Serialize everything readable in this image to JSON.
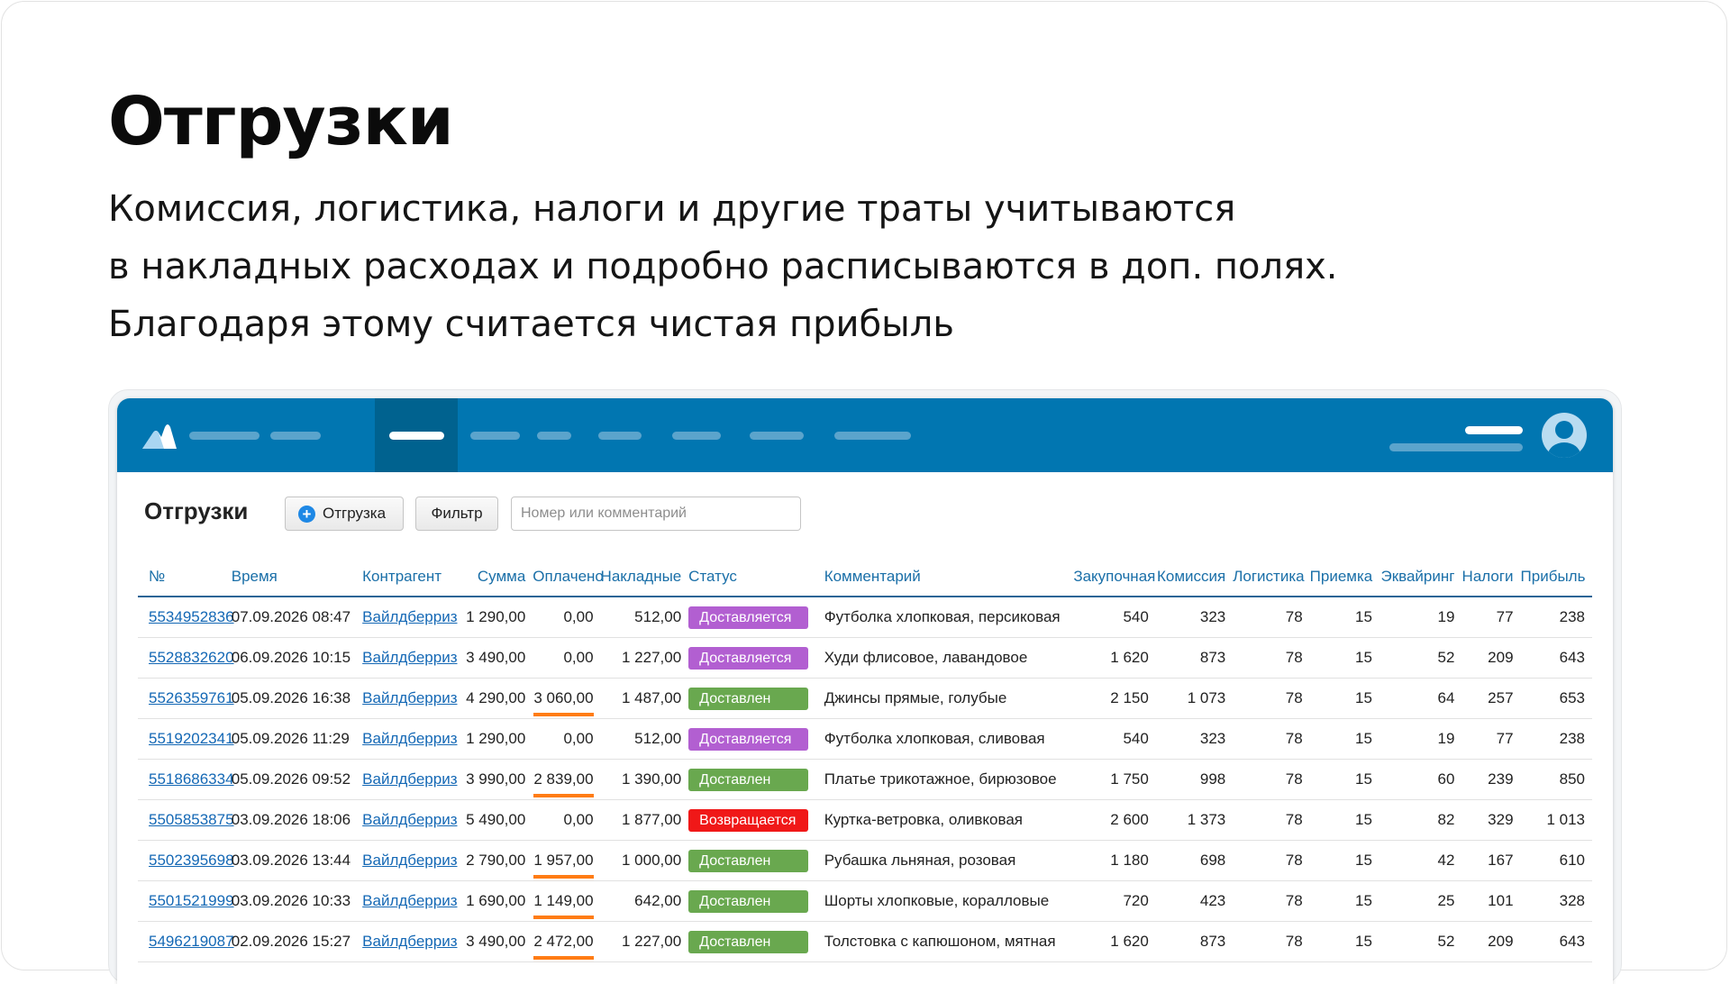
{
  "slide": {
    "title": "Отгрузки",
    "subtitle_lines": [
      "Комиссия, логистика, налоги и другие траты учитываются",
      "в накладных расходах и подробно расписываются в доп. полях.",
      "Благодаря этому считается чистая прибыль"
    ]
  },
  "app": {
    "colors": {
      "topbar": "#0176b1",
      "active_nav": "#00628f",
      "link": "#1468b5",
      "header_text": "#1a6fa8",
      "paid_highlight": "#ff7c14"
    },
    "logo_icon": "logo-icon",
    "avatar_icon": "user-avatar-icon"
  },
  "page": {
    "title": "Отгрузки",
    "add_button_label": "Отгрузка",
    "filter_button_label": "Фильтр",
    "search_placeholder": "Номер или комментарий"
  },
  "status_colors": {
    "Доставляется": "#b25fd1",
    "Доставлен": "#69a84f",
    "Возвращается": "#f01818"
  },
  "table": {
    "columns": [
      "№",
      "Время",
      "Контрагент",
      "Сумма",
      "Оплачено",
      "Накладные",
      "Статус",
      "Комментарий",
      "Закупочная",
      "Комиссия",
      "Логистика",
      "Приемка",
      "Эквайринг",
      "Налоги",
      "Прибыль"
    ],
    "rows": [
      {
        "num": "5534952836",
        "time": "07.09.2026 08:47",
        "agent": "Вайлдберриз",
        "sum": "1 290,00",
        "paid": "0,00",
        "paid_hl": false,
        "overhead": "512,00",
        "status": "Доставляется",
        "comment": "Футболка хлопковая, персиковая",
        "purchase": "540",
        "commission": "323",
        "logistics": "78",
        "acceptance": "15",
        "acquiring": "19",
        "taxes": "77",
        "profit": "238"
      },
      {
        "num": "5528832620",
        "time": "06.09.2026 10:15",
        "agent": "Вайлдберриз",
        "sum": "3 490,00",
        "paid": "0,00",
        "paid_hl": false,
        "overhead": "1 227,00",
        "status": "Доставляется",
        "comment": "Худи флисовое, лавандовое",
        "purchase": "1 620",
        "commission": "873",
        "logistics": "78",
        "acceptance": "15",
        "acquiring": "52",
        "taxes": "209",
        "profit": "643"
      },
      {
        "num": "5526359761",
        "time": "05.09.2026 16:38",
        "agent": "Вайлдберриз",
        "sum": "4 290,00",
        "paid": "3 060,00",
        "paid_hl": true,
        "overhead": "1 487,00",
        "status": "Доставлен",
        "comment": "Джинсы прямые, голубые",
        "purchase": "2 150",
        "commission": "1 073",
        "logistics": "78",
        "acceptance": "15",
        "acquiring": "64",
        "taxes": "257",
        "profit": "653"
      },
      {
        "num": "5519202341",
        "time": "05.09.2026 11:29",
        "agent": "Вайлдберриз",
        "sum": "1 290,00",
        "paid": "0,00",
        "paid_hl": false,
        "overhead": "512,00",
        "status": "Доставляется",
        "comment": "Футболка хлопковая, сливовая",
        "purchase": "540",
        "commission": "323",
        "logistics": "78",
        "acceptance": "15",
        "acquiring": "19",
        "taxes": "77",
        "profit": "238"
      },
      {
        "num": "5518686334",
        "time": "05.09.2026 09:52",
        "agent": "Вайлдберриз",
        "sum": "3 990,00",
        "paid": "2 839,00",
        "paid_hl": true,
        "overhead": "1 390,00",
        "status": "Доставлен",
        "comment": "Платье трикотажное, бирюзовое",
        "purchase": "1 750",
        "commission": "998",
        "logistics": "78",
        "acceptance": "15",
        "acquiring": "60",
        "taxes": "239",
        "profit": "850"
      },
      {
        "num": "5505853875",
        "time": "03.09.2026 18:06",
        "agent": "Вайлдберриз",
        "sum": "5 490,00",
        "paid": "0,00",
        "paid_hl": false,
        "overhead": "1 877,00",
        "status": "Возвращается",
        "comment": "Куртка-ветровка, оливковая",
        "purchase": "2 600",
        "commission": "1 373",
        "logistics": "78",
        "acceptance": "15",
        "acquiring": "82",
        "taxes": "329",
        "profit": "1 013"
      },
      {
        "num": "5502395698",
        "time": "03.09.2026 13:44",
        "agent": "Вайлдберриз",
        "sum": "2 790,00",
        "paid": "1 957,00",
        "paid_hl": true,
        "overhead": "1 000,00",
        "status": "Доставлен",
        "comment": "Рубашка льняная, розовая",
        "purchase": "1 180",
        "commission": "698",
        "logistics": "78",
        "acceptance": "15",
        "acquiring": "42",
        "taxes": "167",
        "profit": "610"
      },
      {
        "num": "5501521999",
        "time": "03.09.2026 10:33",
        "agent": "Вайлдберриз",
        "sum": "1 690,00",
        "paid": "1 149,00",
        "paid_hl": true,
        "overhead": "642,00",
        "status": "Доставлен",
        "comment": "Шорты хлопковые, коралловые",
        "purchase": "720",
        "commission": "423",
        "logistics": "78",
        "acceptance": "15",
        "acquiring": "25",
        "taxes": "101",
        "profit": "328"
      },
      {
        "num": "5496219087",
        "time": "02.09.2026 15:27",
        "agent": "Вайлдберриз",
        "sum": "3 490,00",
        "paid": "2 472,00",
        "paid_hl": true,
        "overhead": "1 227,00",
        "status": "Доставлен",
        "comment": "Толстовка с капюшоном, мятная",
        "purchase": "1 620",
        "commission": "873",
        "logistics": "78",
        "acceptance": "15",
        "acquiring": "52",
        "taxes": "209",
        "profit": "643"
      }
    ]
  }
}
